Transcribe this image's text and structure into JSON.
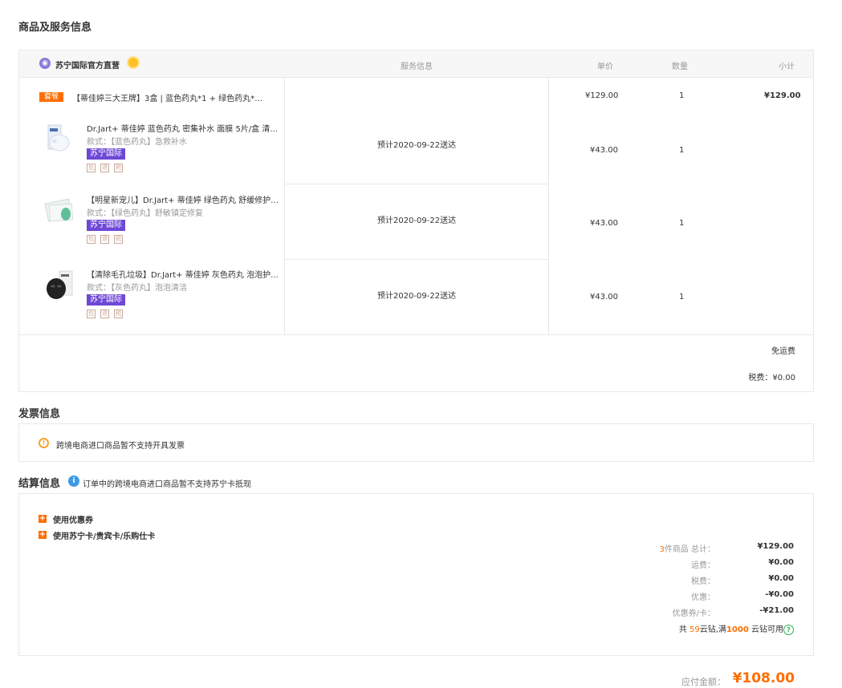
{
  "sections": {
    "goods_title": "商品及服务信息",
    "invoice_title": "发票信息",
    "settle_title": "结算信息"
  },
  "store": {
    "name": "苏宁国际官方直营"
  },
  "columns": {
    "service": "服务信息",
    "unit_price": "单价",
    "quantity": "数量",
    "subtotal": "小计"
  },
  "bundle": {
    "tag": "套餐",
    "title": "【蒂佳婷三大王牌】3盒 | 蓝色药丸*1 + 绿色药丸*1...",
    "unit_price": "¥129.00",
    "quantity": "1",
    "subtotal": "¥129.00"
  },
  "items": [
    {
      "title": "Dr.Jart+ 蒂佳婷 蓝色药丸 密集补水 面膜 5片/盒 清...",
      "spec": "款式：【蓝色药丸】急救补水",
      "tag": "苏宁国际",
      "delivery": "预计2020-09-22送达",
      "price": "¥43.00",
      "quantity": "1"
    },
    {
      "title": "【明星新宠儿】Dr.Jart+ 蒂佳婷 绿色药丸 舒缓修护 ...",
      "spec": "款式：【绿色药丸】舒敏镇定修复",
      "tag": "苏宁国际",
      "delivery": "预计2020-09-22送达",
      "price": "¥43.00",
      "quantity": "1"
    },
    {
      "title": "【清除毛孔垃圾】Dr.Jart+ 蒂佳婷 灰色药丸 泡泡护...",
      "spec": "款式：【灰色药丸】泡泡清洁",
      "tag": "苏宁国际",
      "delivery": "预计2020-09-22送达",
      "price": "¥43.00",
      "quantity": "1"
    }
  ],
  "service_icons": [
    "包",
    "退",
    "税"
  ],
  "shipping": {
    "free": "免运费",
    "tax": "税费：¥0.00"
  },
  "invoice": {
    "notice": "跨境电商进口商品暂不支持开具发票"
  },
  "settle": {
    "note": "订单中的跨境电商进口商品暂不支持苏宁卡抵现",
    "option_coupon": "使用优惠券",
    "option_card": "使用苏宁卡/贵宾卡/乐购仕卡",
    "goods_count": "3",
    "goods_total_label": "件商品 总计：",
    "goods_total": "¥129.00",
    "freight_label": "运费：",
    "freight": "¥0.00",
    "tax_label": "税费：",
    "tax": "¥0.00",
    "discount_label": "优惠：",
    "discount": "-¥0.00",
    "coupon_label": "优惠券/卡：",
    "coupon": "-¥21.00",
    "cloud_prefix": "共",
    "cloud_count": "59",
    "cloud_mid": "云钻,满",
    "cloud_threshold": "1000",
    "cloud_suffix": "云钻可用",
    "pay_label": "应付金额：",
    "pay_amount": "¥108.00"
  }
}
